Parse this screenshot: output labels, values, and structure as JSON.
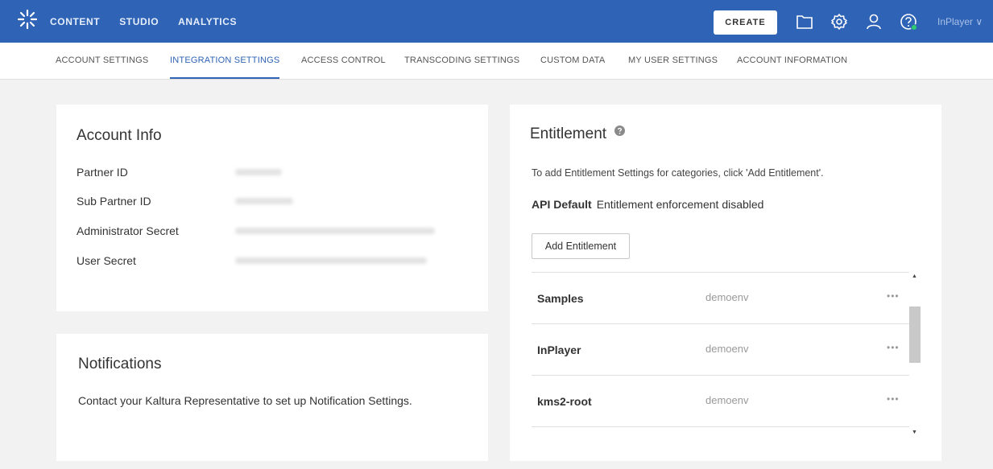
{
  "topbar": {
    "nav": [
      "CONTENT",
      "STUDIO",
      "ANALYTICS"
    ],
    "create_label": "CREATE",
    "user_label": "InPlayer ∨",
    "brand_color": "#2f63b5"
  },
  "subnav": {
    "tabs": [
      {
        "label": "ACCOUNT SETTINGS"
      },
      {
        "label": "INTEGRATION SETTINGS",
        "active": true
      },
      {
        "label": "ACCESS CONTROL"
      },
      {
        "label": "TRANSCODING SETTINGS"
      },
      {
        "label": "CUSTOM DATA"
      },
      {
        "label": "MY USER SETTINGS"
      },
      {
        "label": "ACCOUNT INFORMATION"
      }
    ]
  },
  "account_info": {
    "title": "Account Info",
    "fields": [
      {
        "label": "Partner ID"
      },
      {
        "label": "Sub Partner ID"
      },
      {
        "label": "Administrator Secret"
      },
      {
        "label": "User Secret"
      }
    ]
  },
  "notifications": {
    "title": "Notifications",
    "text": "Contact your Kaltura Representative to set up Notification Settings."
  },
  "entitlement": {
    "title": "Entitlement",
    "description": "To add Entitlement Settings for categories, click 'Add Entitlement'.",
    "api_default_label": "API Default",
    "api_default_value": "Entitlement enforcement disabled",
    "add_button": "Add Entitlement",
    "rows": [
      {
        "name": "Samples",
        "env": "demoenv"
      },
      {
        "name": "InPlayer",
        "env": "demoenv"
      },
      {
        "name": "kms2-root",
        "env": "demoenv"
      }
    ],
    "more_label": "•••"
  },
  "icons": {
    "logo": "kaltura-logo",
    "folder": "folder-icon",
    "settings": "gear-icon",
    "user": "user-icon",
    "help": "help-icon",
    "entitlement_help": "help-circle-icon"
  }
}
